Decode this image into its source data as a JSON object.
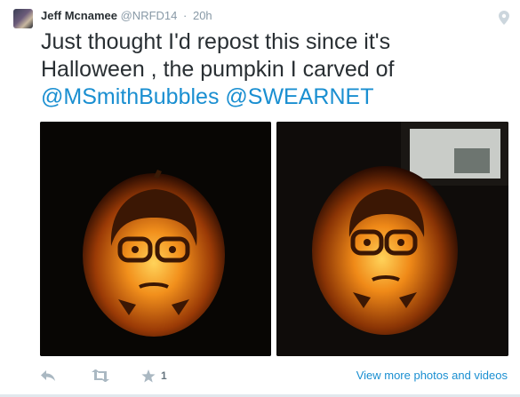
{
  "tweet": {
    "author_name": "Jeff Mcnamee",
    "author_handle": "@NRFD14",
    "separator": "·",
    "time": "20h",
    "text_line1": "Just thought I'd repost this since it's",
    "text_line2": "Halloween , the pumpkin I carved of",
    "mention1": "@MSmithBubbles",
    "mention2": "@SWEARNET"
  },
  "actions": {
    "favorite_count": "1",
    "view_more_label": "View more photos and videos"
  },
  "icons": {
    "reply": "reply-icon",
    "retweet": "retweet-icon",
    "favorite": "star-icon",
    "geo": "location-pin-icon"
  },
  "colors": {
    "link": "#1a8fd1",
    "text": "#292f33",
    "muted": "#8899a6",
    "pumpkin_glow": "#f5a623"
  }
}
